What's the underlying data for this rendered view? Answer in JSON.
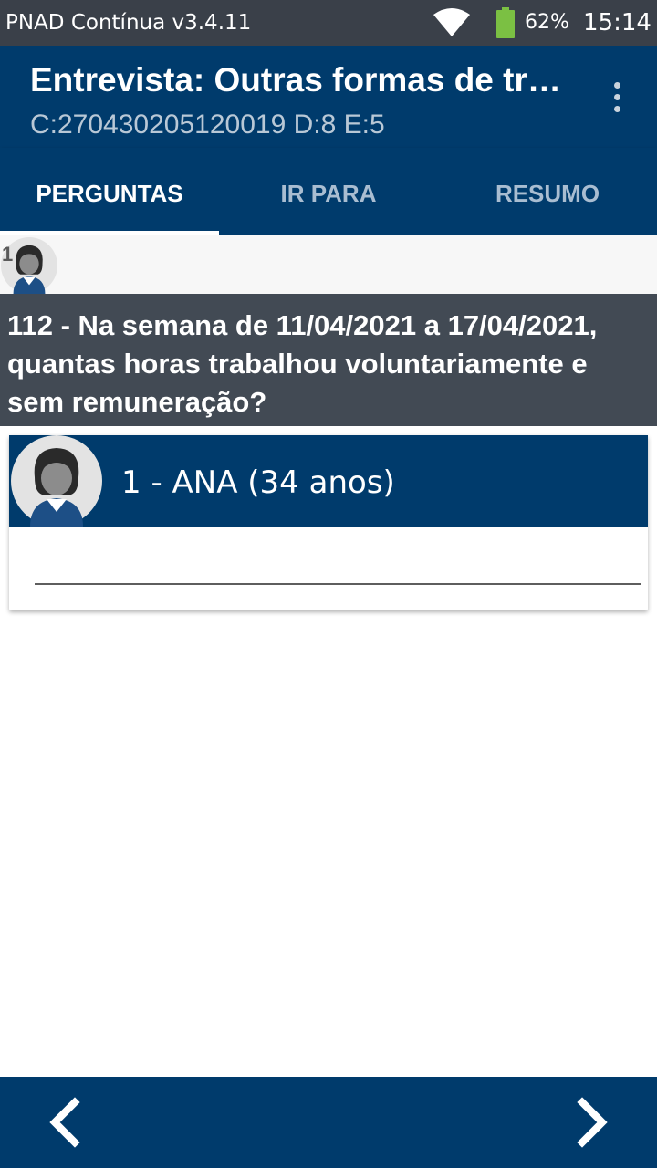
{
  "status_bar": {
    "app_name": "PNAD Contínua v3.4.11",
    "battery_percent": "62%",
    "battery_level": 0.62,
    "time": "15:14",
    "icons": [
      "wifi-icon",
      "battery-icon"
    ]
  },
  "app_bar": {
    "title": "Entrevista: Outras formas de tr…",
    "subtitle": "C:270430205120019 D:8 E:5",
    "menu_icon": "overflow-menu-icon"
  },
  "tabs": [
    {
      "label": "PERGUNTAS",
      "active": true
    },
    {
      "label": "IR PARA",
      "active": false
    },
    {
      "label": "RESUMO",
      "active": false
    }
  ],
  "respondent_strip": {
    "number": "1"
  },
  "question": {
    "text": "112 - Na semana de 11/04/2021 a 17/04/2021, quantas horas trabalhou voluntariamente e sem remuneração?"
  },
  "person_card": {
    "name": "1 - ANA (34 anos)",
    "answer_value": ""
  },
  "navigation": {
    "prev_icon": "chevron-left-icon",
    "next_icon": "chevron-right-icon"
  },
  "colors": {
    "primary": "#003b6c",
    "status_bar": "#3a4049",
    "question_bg": "#424a54",
    "battery_green": "#7bc043"
  }
}
